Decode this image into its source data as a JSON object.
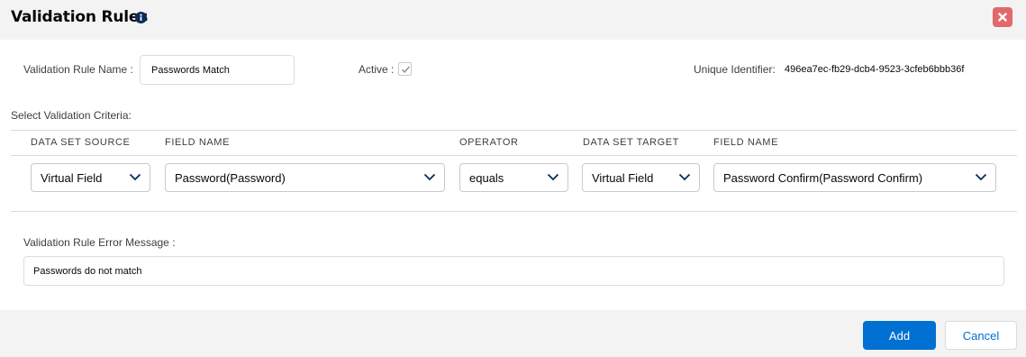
{
  "header": {
    "title": "Validation Rules",
    "info_icon": "info-icon",
    "close_icon": "close-icon"
  },
  "form": {
    "rule_name_label": "Validation Rule Name :",
    "rule_name_value": "Passwords Match",
    "active_label": "Active :",
    "active_checked": true,
    "unique_id_label": "Unique Identifier:",
    "unique_id_value": "496ea7ec-fb29-dcb4-9523-3cfeb6bbb36f",
    "criteria_label": "Select Validation Criteria:",
    "error_message_label": "Validation Rule Error Message :",
    "error_message_value": "Passwords do not match"
  },
  "criteria": {
    "headers": [
      "DATA SET SOURCE",
      "FIELD NAME",
      "OPERATOR",
      "DATA SET TARGET",
      "FIELD NAME"
    ],
    "source": "Virtual Field",
    "source_field": "Password(Password)",
    "operator": "equals",
    "target": "Virtual Field",
    "target_field": "Password Confirm(Password Confirm)"
  },
  "footer": {
    "add_label": "Add",
    "cancel_label": "Cancel"
  },
  "colors": {
    "primary": "#0070d2",
    "close": "#e2686b",
    "panel": "#f3f3f3"
  }
}
